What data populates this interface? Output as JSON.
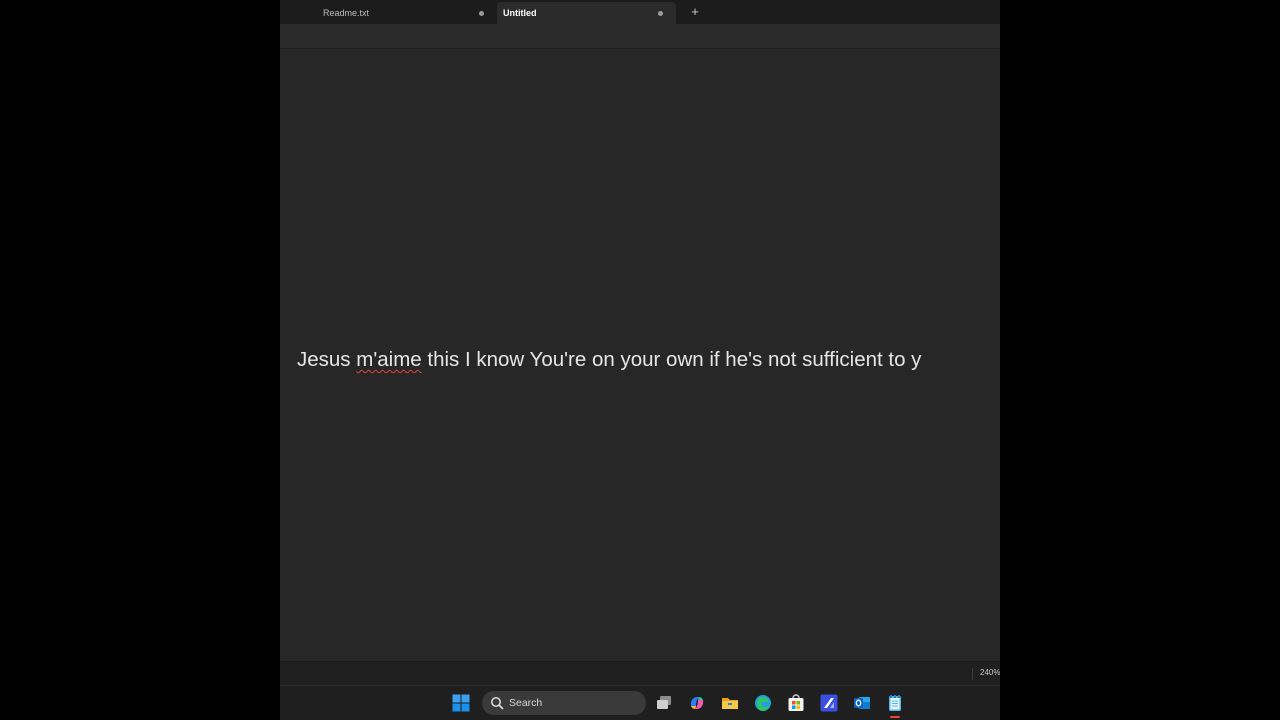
{
  "tabs": [
    {
      "label": "Readme.txt",
      "active": false,
      "unsaved": true
    },
    {
      "label": "Untitled",
      "active": true,
      "unsaved": true
    }
  ],
  "new_tab_label": "+",
  "editor": {
    "line_before": "Jesus ",
    "misspelled_word": "m'aime",
    "line_after": " this I know You're on your own if he's not sufficient to y"
  },
  "status": {
    "zoom": "240%"
  },
  "taskbar": {
    "search_label": "Search",
    "items": [
      "start",
      "search",
      "task-view",
      "copilot",
      "file-explorer",
      "edge",
      "microsoft-store",
      "app",
      "outlook",
      "notepad"
    ]
  },
  "colors": {
    "editor_bg": "#272727",
    "tabbar_bg": "#1c1c1c",
    "spellcheck": "#e0413b",
    "windows_blue": "#1e8fe8",
    "notepad_accent": "#e64a3c"
  }
}
